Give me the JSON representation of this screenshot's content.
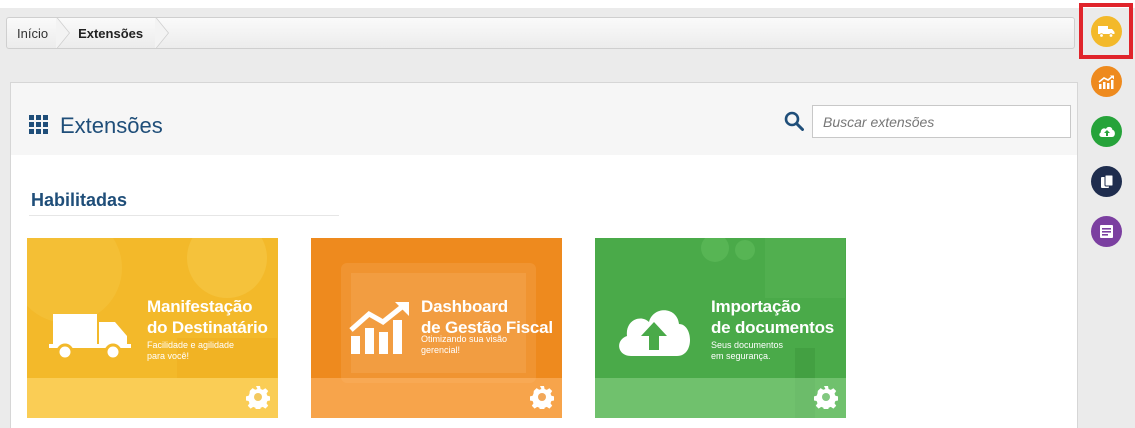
{
  "breadcrumb": {
    "home": "Início",
    "current": "Extensões"
  },
  "header": {
    "title": "Extensões",
    "grid_icon": "grid-icon",
    "search_icon": "search-icon",
    "search_placeholder": "Buscar extensões",
    "search_value": ""
  },
  "section": {
    "title": "Habilitadas"
  },
  "cards": [
    {
      "title": "Manifestação\ndo Destinatário",
      "subtitle": "Facilidade e agilidade\npara você!",
      "icon": "truck-icon",
      "color": "#f3b92a"
    },
    {
      "title": "Dashboard\nde Gestão Fiscal",
      "subtitle": "Otimizando sua visão\ngerencial!",
      "icon": "chart-growth-icon",
      "color": "#ee8a1e"
    },
    {
      "title": "Importação\nde documentos",
      "subtitle": "Seus documentos\nem segurança.",
      "icon": "cloud-upload-icon",
      "color": "#4aaa49"
    }
  ],
  "rail": [
    {
      "icon": "truck-icon",
      "color": "#f3b92a",
      "highlighted": true
    },
    {
      "icon": "chart-growth-icon",
      "color": "#ee8a1e"
    },
    {
      "icon": "cloud-upload-icon",
      "color": "#26a33a"
    },
    {
      "icon": "documents-icon",
      "color": "#1f2d4e"
    },
    {
      "icon": "form-icon",
      "color": "#7b3fa0"
    }
  ],
  "colors": {
    "accent": "#1f4e79",
    "highlight": "#e0242b"
  }
}
